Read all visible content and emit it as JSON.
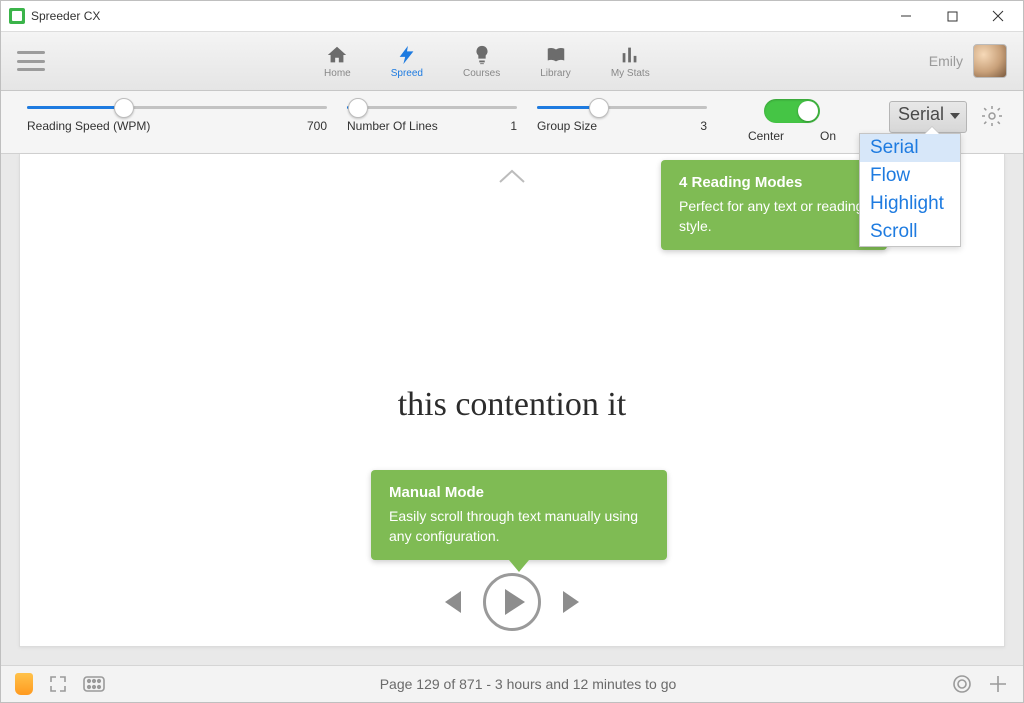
{
  "window": {
    "title": "Spreeder CX"
  },
  "user": {
    "name": "Emily"
  },
  "nav": {
    "home": {
      "label": "Home"
    },
    "spreed": {
      "label": "Spreed"
    },
    "courses": {
      "label": "Courses"
    },
    "library": {
      "label": "Library"
    },
    "stats": {
      "label": "My Stats"
    }
  },
  "controls": {
    "speed": {
      "label": "Reading Speed (WPM)",
      "value": "700",
      "fill_pct": 32
    },
    "lines": {
      "label": "Number Of Lines",
      "value": "1",
      "fill_pct": 6
    },
    "group": {
      "label": "Group Size",
      "value": "3",
      "fill_pct": 36
    },
    "center": {
      "label": "Center",
      "state": "On"
    }
  },
  "modes": {
    "selected": "Serial",
    "options": [
      "Serial",
      "Flow",
      "Highlight",
      "Scroll"
    ]
  },
  "reader": {
    "text": "this contention it"
  },
  "tooltips": {
    "t1": {
      "title": "4 Reading Modes",
      "body": "Perfect for any text or reading style."
    },
    "t2": {
      "title": "Manual Mode",
      "body": "Easily scroll through text manually using any configuration."
    }
  },
  "status": {
    "text": "Page 129 of 871 - 3 hours and 12 minutes to go"
  }
}
